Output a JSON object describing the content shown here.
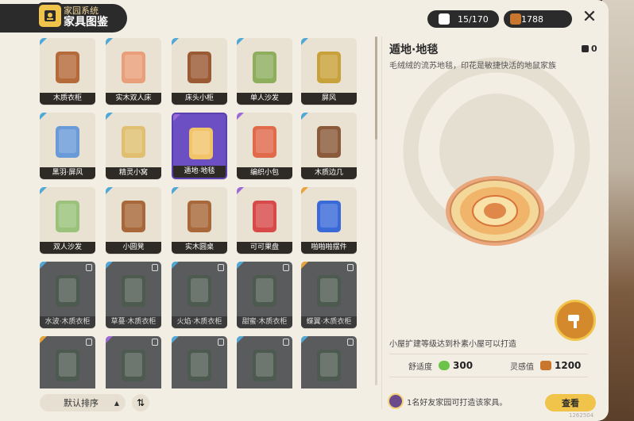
{
  "header": {
    "subtitle": "家园系统",
    "title": "家具图鉴",
    "collection_count": "15/170",
    "currency": "1788",
    "close_label": "✕"
  },
  "catalog": {
    "items": [
      {
        "label": "木质衣柜",
        "rarity": "blue",
        "locked": false
      },
      {
        "label": "实木双人床",
        "rarity": "blue",
        "locked": false
      },
      {
        "label": "床头小柜",
        "rarity": "blue",
        "locked": false
      },
      {
        "label": "单人沙发",
        "rarity": "blue",
        "locked": false
      },
      {
        "label": "屏风",
        "rarity": "blue",
        "locked": false
      },
      {
        "label": "黑羽·屏风",
        "rarity": "blue",
        "locked": false
      },
      {
        "label": "精灵小窝",
        "rarity": "blue",
        "locked": false
      },
      {
        "label": "遁地·地毯",
        "rarity": "purple",
        "locked": false,
        "selected": true
      },
      {
        "label": "编织小包",
        "rarity": "purple",
        "locked": false
      },
      {
        "label": "木质边几",
        "rarity": "blue",
        "locked": false
      },
      {
        "label": "双人沙发",
        "rarity": "blue",
        "locked": false
      },
      {
        "label": "小圆凳",
        "rarity": "blue",
        "locked": false
      },
      {
        "label": "实木圆桌",
        "rarity": "blue",
        "locked": false
      },
      {
        "label": "可可果盘",
        "rarity": "purple",
        "locked": false
      },
      {
        "label": "啪啪啪摆件",
        "rarity": "gold",
        "locked": false
      },
      {
        "label": "水波·木质衣柜",
        "rarity": "blue",
        "locked": true
      },
      {
        "label": "草蔓·木质衣柜",
        "rarity": "blue",
        "locked": true
      },
      {
        "label": "火焰·木质衣柜",
        "rarity": "blue",
        "locked": true
      },
      {
        "label": "甜蜜·木质衣柜",
        "rarity": "blue",
        "locked": true
      },
      {
        "label": "蝶翼·木质衣柜",
        "rarity": "gold",
        "locked": true
      },
      {
        "label": "",
        "rarity": "gold",
        "locked": true
      },
      {
        "label": "",
        "rarity": "purple",
        "locked": true
      },
      {
        "label": "",
        "rarity": "blue",
        "locked": true
      },
      {
        "label": "",
        "rarity": "blue",
        "locked": true
      },
      {
        "label": "",
        "rarity": "blue",
        "locked": true
      }
    ]
  },
  "controls": {
    "sort_label": "默认排序",
    "sort_arrow": "▲",
    "order_label": "⇅"
  },
  "detail": {
    "name": "遁地·地毯",
    "owned": "0",
    "description": "毛绒绒的流苏地毯，印花是敏捷快活的地鼠家族",
    "unlock_hint": "小屋扩建等级达到朴素小屋可以打造",
    "comfort_label": "舒适度",
    "comfort_value": "300",
    "inspiration_label": "灵感值",
    "inspiration_value": "1200",
    "friend_hint": "1名好友家园可打造该家具。",
    "view_label": "查看",
    "uid": "1262504"
  },
  "colors": {
    "rarity_blue": "#4fa8d6",
    "rarity_purple": "#9b6ad8",
    "rarity_gold": "#e8a33b",
    "accent": "#f0c34a",
    "dark": "#2b2b2b"
  }
}
